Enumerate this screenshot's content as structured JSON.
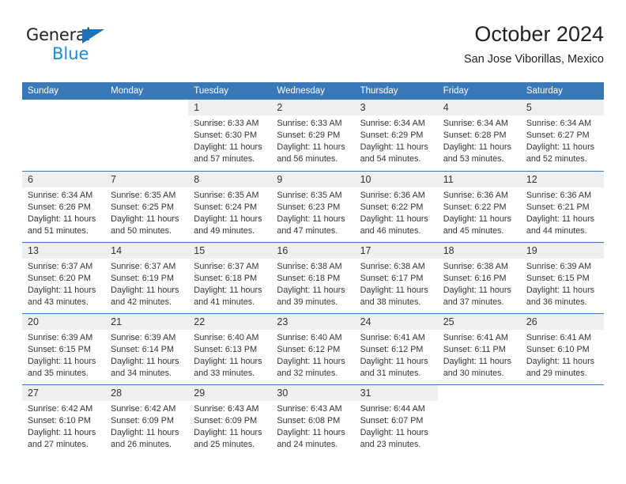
{
  "brand": {
    "name_top": "General",
    "name_bottom": "Blue",
    "triangle_color": "#1e72b8",
    "blue_text_color": "#1e8ad6"
  },
  "header": {
    "title": "October 2024",
    "subtitle": "San Jose Viborillas, Mexico"
  },
  "theme": {
    "header_blue": "#3b78b8",
    "daynum_bg": "#efefef",
    "text": "#333333"
  },
  "weekday_headers": [
    "Sunday",
    "Monday",
    "Tuesday",
    "Wednesday",
    "Thursday",
    "Friday",
    "Saturday"
  ],
  "labels": {
    "sunrise_prefix": "Sunrise: ",
    "sunset_prefix": "Sunset: ",
    "daylight_prefix": "Daylight: "
  },
  "weeks": [
    [
      {
        "day": "",
        "sunrise": "",
        "sunset": "",
        "daylight": ""
      },
      {
        "day": "",
        "sunrise": "",
        "sunset": "",
        "daylight": ""
      },
      {
        "day": "1",
        "sunrise": "Sunrise: 6:33 AM",
        "sunset": "Sunset: 6:30 PM",
        "daylight": "Daylight: 11 hours and 57 minutes."
      },
      {
        "day": "2",
        "sunrise": "Sunrise: 6:33 AM",
        "sunset": "Sunset: 6:29 PM",
        "daylight": "Daylight: 11 hours and 56 minutes."
      },
      {
        "day": "3",
        "sunrise": "Sunrise: 6:34 AM",
        "sunset": "Sunset: 6:29 PM",
        "daylight": "Daylight: 11 hours and 54 minutes."
      },
      {
        "day": "4",
        "sunrise": "Sunrise: 6:34 AM",
        "sunset": "Sunset: 6:28 PM",
        "daylight": "Daylight: 11 hours and 53 minutes."
      },
      {
        "day": "5",
        "sunrise": "Sunrise: 6:34 AM",
        "sunset": "Sunset: 6:27 PM",
        "daylight": "Daylight: 11 hours and 52 minutes."
      }
    ],
    [
      {
        "day": "6",
        "sunrise": "Sunrise: 6:34 AM",
        "sunset": "Sunset: 6:26 PM",
        "daylight": "Daylight: 11 hours and 51 minutes."
      },
      {
        "day": "7",
        "sunrise": "Sunrise: 6:35 AM",
        "sunset": "Sunset: 6:25 PM",
        "daylight": "Daylight: 11 hours and 50 minutes."
      },
      {
        "day": "8",
        "sunrise": "Sunrise: 6:35 AM",
        "sunset": "Sunset: 6:24 PM",
        "daylight": "Daylight: 11 hours and 49 minutes."
      },
      {
        "day": "9",
        "sunrise": "Sunrise: 6:35 AM",
        "sunset": "Sunset: 6:23 PM",
        "daylight": "Daylight: 11 hours and 47 minutes."
      },
      {
        "day": "10",
        "sunrise": "Sunrise: 6:36 AM",
        "sunset": "Sunset: 6:22 PM",
        "daylight": "Daylight: 11 hours and 46 minutes."
      },
      {
        "day": "11",
        "sunrise": "Sunrise: 6:36 AM",
        "sunset": "Sunset: 6:22 PM",
        "daylight": "Daylight: 11 hours and 45 minutes."
      },
      {
        "day": "12",
        "sunrise": "Sunrise: 6:36 AM",
        "sunset": "Sunset: 6:21 PM",
        "daylight": "Daylight: 11 hours and 44 minutes."
      }
    ],
    [
      {
        "day": "13",
        "sunrise": "Sunrise: 6:37 AM",
        "sunset": "Sunset: 6:20 PM",
        "daylight": "Daylight: 11 hours and 43 minutes."
      },
      {
        "day": "14",
        "sunrise": "Sunrise: 6:37 AM",
        "sunset": "Sunset: 6:19 PM",
        "daylight": "Daylight: 11 hours and 42 minutes."
      },
      {
        "day": "15",
        "sunrise": "Sunrise: 6:37 AM",
        "sunset": "Sunset: 6:18 PM",
        "daylight": "Daylight: 11 hours and 41 minutes."
      },
      {
        "day": "16",
        "sunrise": "Sunrise: 6:38 AM",
        "sunset": "Sunset: 6:18 PM",
        "daylight": "Daylight: 11 hours and 39 minutes."
      },
      {
        "day": "17",
        "sunrise": "Sunrise: 6:38 AM",
        "sunset": "Sunset: 6:17 PM",
        "daylight": "Daylight: 11 hours and 38 minutes."
      },
      {
        "day": "18",
        "sunrise": "Sunrise: 6:38 AM",
        "sunset": "Sunset: 6:16 PM",
        "daylight": "Daylight: 11 hours and 37 minutes."
      },
      {
        "day": "19",
        "sunrise": "Sunrise: 6:39 AM",
        "sunset": "Sunset: 6:15 PM",
        "daylight": "Daylight: 11 hours and 36 minutes."
      }
    ],
    [
      {
        "day": "20",
        "sunrise": "Sunrise: 6:39 AM",
        "sunset": "Sunset: 6:15 PM",
        "daylight": "Daylight: 11 hours and 35 minutes."
      },
      {
        "day": "21",
        "sunrise": "Sunrise: 6:39 AM",
        "sunset": "Sunset: 6:14 PM",
        "daylight": "Daylight: 11 hours and 34 minutes."
      },
      {
        "day": "22",
        "sunrise": "Sunrise: 6:40 AM",
        "sunset": "Sunset: 6:13 PM",
        "daylight": "Daylight: 11 hours and 33 minutes."
      },
      {
        "day": "23",
        "sunrise": "Sunrise: 6:40 AM",
        "sunset": "Sunset: 6:12 PM",
        "daylight": "Daylight: 11 hours and 32 minutes."
      },
      {
        "day": "24",
        "sunrise": "Sunrise: 6:41 AM",
        "sunset": "Sunset: 6:12 PM",
        "daylight": "Daylight: 11 hours and 31 minutes."
      },
      {
        "day": "25",
        "sunrise": "Sunrise: 6:41 AM",
        "sunset": "Sunset: 6:11 PM",
        "daylight": "Daylight: 11 hours and 30 minutes."
      },
      {
        "day": "26",
        "sunrise": "Sunrise: 6:41 AM",
        "sunset": "Sunset: 6:10 PM",
        "daylight": "Daylight: 11 hours and 29 minutes."
      }
    ],
    [
      {
        "day": "27",
        "sunrise": "Sunrise: 6:42 AM",
        "sunset": "Sunset: 6:10 PM",
        "daylight": "Daylight: 11 hours and 27 minutes."
      },
      {
        "day": "28",
        "sunrise": "Sunrise: 6:42 AM",
        "sunset": "Sunset: 6:09 PM",
        "daylight": "Daylight: 11 hours and 26 minutes."
      },
      {
        "day": "29",
        "sunrise": "Sunrise: 6:43 AM",
        "sunset": "Sunset: 6:09 PM",
        "daylight": "Daylight: 11 hours and 25 minutes."
      },
      {
        "day": "30",
        "sunrise": "Sunrise: 6:43 AM",
        "sunset": "Sunset: 6:08 PM",
        "daylight": "Daylight: 11 hours and 24 minutes."
      },
      {
        "day": "31",
        "sunrise": "Sunrise: 6:44 AM",
        "sunset": "Sunset: 6:07 PM",
        "daylight": "Daylight: 11 hours and 23 minutes."
      },
      {
        "day": "",
        "sunrise": "",
        "sunset": "",
        "daylight": ""
      },
      {
        "day": "",
        "sunrise": "",
        "sunset": "",
        "daylight": ""
      }
    ]
  ]
}
